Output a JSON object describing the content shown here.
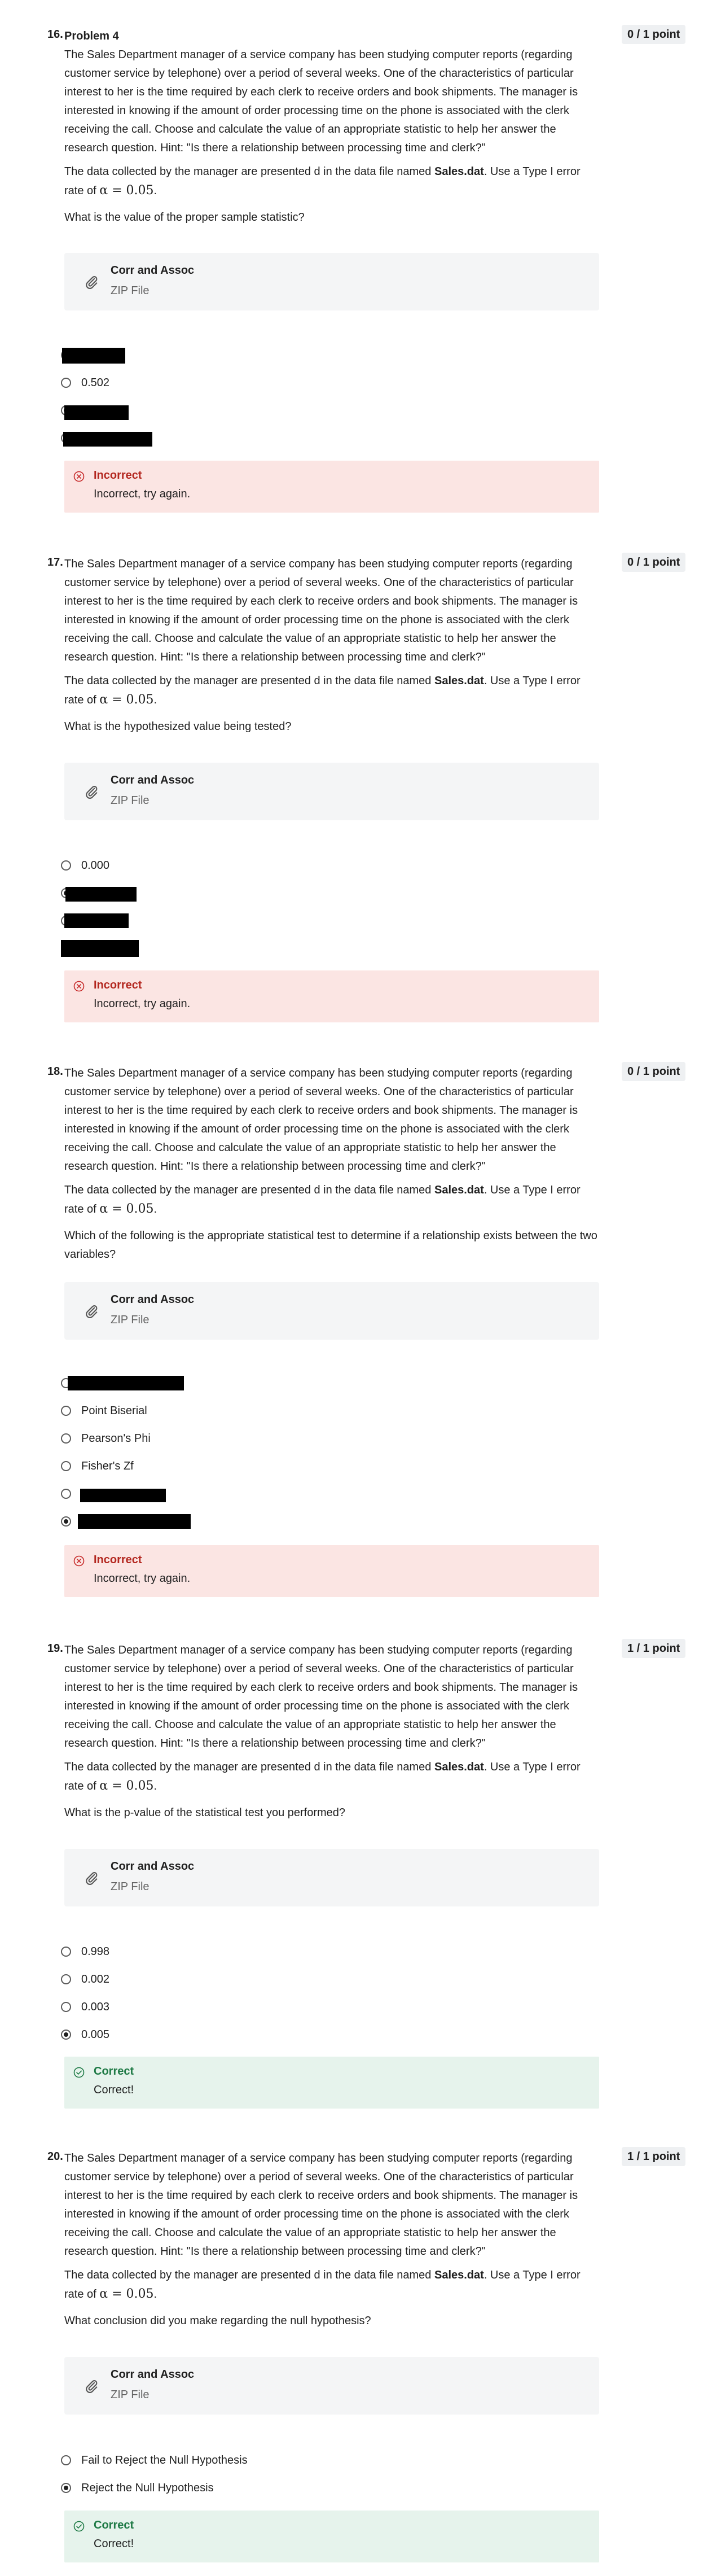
{
  "common": {
    "problem_text": "The Sales Department manager of a service company has been studying computer reports (regarding customer service by telephone) over a period of several weeks. One of the characteristics of particular interest to her is the time required by each clerk to receive orders and book shipments. The manager is interested in knowing if the amount of order processing time on the phone is associated with the clerk receiving the call. Choose and calculate the value of an appropriate statistic to help her answer the research question. Hint: \"Is there a relationship between processing time and clerk?\"",
    "data_text_before": "The data collected by the manager are presented d in the data file named ",
    "data_file": "Sales.dat",
    "data_text_after": ". Use a Type I error rate of ",
    "alpha": "α = 0.05",
    "alpha_end": ".",
    "attachment_name": "Corr and Assoc",
    "attachment_type": "ZIP File"
  },
  "questions": [
    {
      "number": "16.",
      "title": "Problem 4",
      "points": "0 / 1 point",
      "prompt": "What is the value of the proper sample statistic?",
      "options": [
        {
          "label": "",
          "checked": false,
          "redacted": true
        },
        {
          "label": "0.502",
          "checked": false,
          "redacted": false
        },
        {
          "label": "",
          "checked": true,
          "redacted": true
        },
        {
          "label": "",
          "checked": false,
          "redacted": true
        }
      ],
      "feedback": {
        "status": "incorrect",
        "title": "Incorrect",
        "text": "Incorrect, try again."
      }
    },
    {
      "number": "17.",
      "title": "",
      "points": "0 / 1 point",
      "prompt": "What is the hypothesized value being tested?",
      "options": [
        {
          "label": "0.000",
          "checked": false,
          "redacted": false
        },
        {
          "label": "",
          "checked": true,
          "redacted": true
        },
        {
          "label": "",
          "checked": false,
          "redacted": true
        },
        {
          "label": "",
          "checked": false,
          "redacted": true
        }
      ],
      "feedback": {
        "status": "incorrect",
        "title": "Incorrect",
        "text": "Incorrect, try again."
      }
    },
    {
      "number": "18.",
      "title": "",
      "points": "0 / 1 point",
      "prompt": "Which of the following is the appropriate statistical test to determine if a relationship exists between the two variables?",
      "options": [
        {
          "label": "",
          "checked": false,
          "redacted": true
        },
        {
          "label": "Point Biserial",
          "checked": false,
          "redacted": false
        },
        {
          "label": "Pearson's Phi",
          "checked": false,
          "redacted": false
        },
        {
          "label": "Fisher's Zf",
          "checked": false,
          "redacted": false
        },
        {
          "label": "",
          "checked": false,
          "redacted": true
        },
        {
          "label": "",
          "checked": true,
          "redacted": true
        }
      ],
      "feedback": {
        "status": "incorrect",
        "title": "Incorrect",
        "text": "Incorrect, try again."
      }
    },
    {
      "number": "19.",
      "title": "",
      "points": "1 / 1 point",
      "prompt": "What is the p-value of the statistical test you performed?",
      "options": [
        {
          "label": "0.998",
          "checked": false,
          "redacted": false
        },
        {
          "label": "0.002",
          "checked": false,
          "redacted": false
        },
        {
          "label": "0.003",
          "checked": false,
          "redacted": false
        },
        {
          "label": "0.005",
          "checked": true,
          "redacted": false
        }
      ],
      "feedback": {
        "status": "correct",
        "title": "Correct",
        "text": "Correct!"
      }
    },
    {
      "number": "20.",
      "title": "",
      "points": "1 / 1 point",
      "prompt": "What conclusion did you make regarding the null hypothesis?",
      "options": [
        {
          "label": "Fail to Reject the Null Hypothesis",
          "checked": false,
          "redacted": false
        },
        {
          "label": "Reject the Null Hypothesis",
          "checked": true,
          "redacted": false
        }
      ],
      "feedback": {
        "status": "correct",
        "title": "Correct",
        "text": "Correct!"
      }
    }
  ]
}
